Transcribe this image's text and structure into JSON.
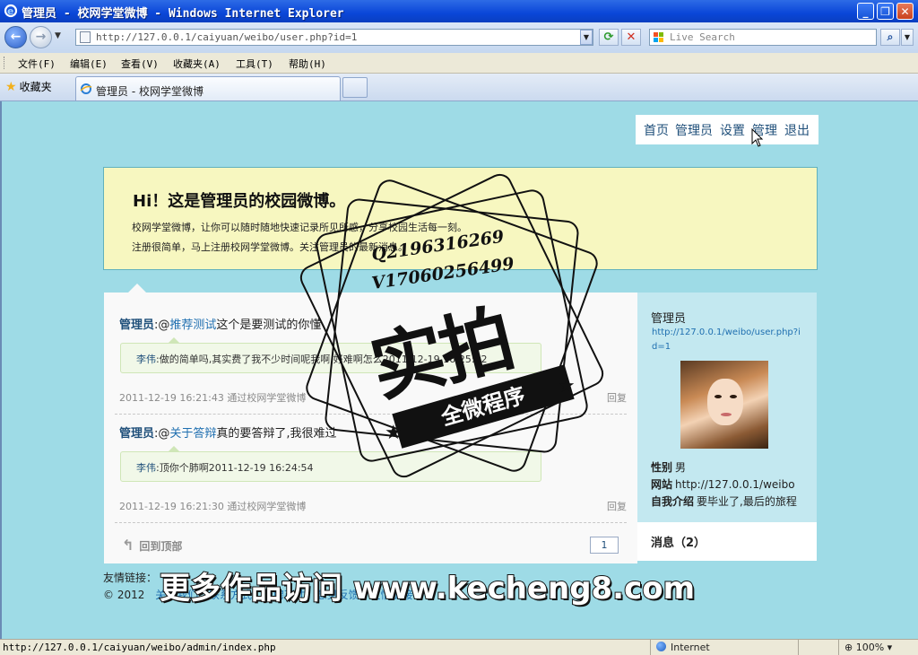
{
  "window": {
    "title": "管理员 - 校网学堂微博 - Windows Internet Explorer",
    "min_icon": "minimize-icon",
    "max_icon": "maximize-icon",
    "close_icon": "close-icon"
  },
  "address": {
    "url": "http://127.0.0.1/caiyuan/weibo/user.php?id=1",
    "search_placeholder": "Live Search",
    "refresh_glyph": "⟳",
    "stop_glyph": "✕",
    "search_glyph": "⌕",
    "back_glyph": "←",
    "forward_glyph": "→"
  },
  "menu": [
    "文件(F)",
    "编辑(E)",
    "查看(V)",
    "收藏夹(A)",
    "工具(T)",
    "帮助(H)"
  ],
  "tabs": {
    "favorites_label": "收藏夹",
    "active_tab": "管理员 - 校网学堂微博"
  },
  "site": {
    "nav": [
      "首页",
      "管理员",
      "设置",
      "管理",
      "退出"
    ],
    "banner": {
      "title": "Hi！这是管理员的校园微博。",
      "line1": "校网学堂微博，让你可以随时随地快速记录所见所感，分享校园生活每一刻。",
      "line2": "注册很简单，马上注册校网学堂微博。关注管理员的最新消息。"
    },
    "posts": [
      {
        "author": "管理员",
        "mention": ":@",
        "topic": "推荐测试",
        "text": "这个是要测试的你懂",
        "reply_author": "李伟",
        "reply_text": ":做的简单吗,其实费了我不少时间呢我啊,好难啊怎么2011-12-19 16:25:22",
        "meta": "2011-12-19 16:21:43 通过校网学堂微博",
        "reply_label": "回复"
      },
      {
        "author": "管理员",
        "mention": ":@",
        "topic": "关于答辩",
        "text": "真的要答辩了,我很难过",
        "reply_author": "李伟",
        "reply_text": ":顶你个肺啊2011-12-19 16:24:54",
        "meta": "2011-12-19 16:21:30 通过校网学堂微博",
        "reply_label": "回复"
      }
    ],
    "back_to_top": "回到顶部",
    "page_number": "1",
    "sidebar": {
      "name": "管理员",
      "url": "http://127.0.0.1/weibo/user.php?id=1",
      "gender_label": "性别",
      "gender": "男",
      "website_label": "网站",
      "website": "http://127.0.0.1/weibo",
      "bio_label": "自我介绍",
      "bio": "要毕业了,最后的旅程"
    },
    "messages_label": "消息（2）",
    "footer": {
      "links_label": "友情链接：",
      "copyright": "© 2012",
      "copyright_links": [
        "关于我们",
        "联系方式",
        "诚聘英才",
        "意见反馈",
        "友情链接"
      ]
    }
  },
  "watermark": {
    "qq": "Q2196316269",
    "v": "V17060256499",
    "main": "实拍",
    "ribbon": "全微程序",
    "caption": "更多作品访问 www.kecheng8.com"
  },
  "status": {
    "url": "http://127.0.0.1/caiyuan/weibo/admin/index.php",
    "zone": "Internet",
    "zoom": "100%"
  }
}
